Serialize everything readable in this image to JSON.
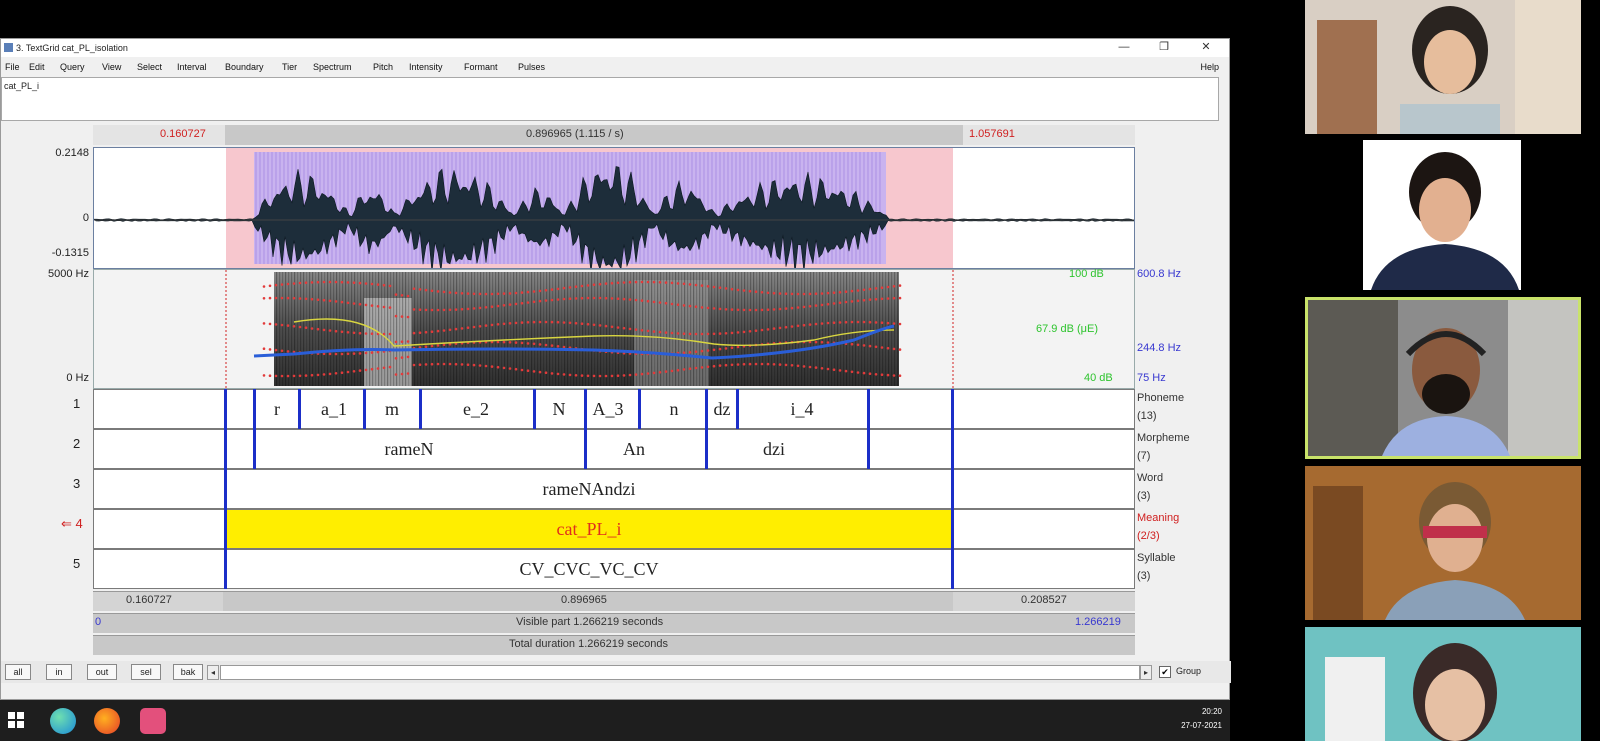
{
  "window": {
    "title": "3. TextGrid cat_PL_isolation",
    "minimize": "—",
    "restore": "❐",
    "close": "✕"
  },
  "menu": [
    "File",
    "Edit",
    "Query",
    "View",
    "Select",
    "Interval",
    "Boundary",
    "Tier",
    "Spectrum",
    "Pitch",
    "Intensity",
    "Formant",
    "Pulses"
  ],
  "menu_help": "Help",
  "text_field": "cat_PL_i",
  "selection": {
    "start": "0.160727",
    "duration": "0.896965 (1.115 / s)",
    "end": "1.057691"
  },
  "waveform": {
    "max": "0.2148",
    "zero": "0",
    "min": "-0.1315"
  },
  "spectrogram": {
    "top_hz": "5000 Hz",
    "bottom_hz": "0 Hz",
    "right_top_db": "100 dB",
    "right_top_hz": "600.8 Hz",
    "right_mid_db": "67.9 dB (μE)",
    "right_mid_hz": "244.8 Hz",
    "right_bot_db": "40 dB",
    "right_bot_hz": "75 Hz"
  },
  "tiers": [
    {
      "num": "1",
      "name": "Phoneme",
      "count": "(13)"
    },
    {
      "num": "2",
      "name": "Morpheme",
      "count": "(7)"
    },
    {
      "num": "3",
      "name": "Word",
      "count": "(3)"
    },
    {
      "num": "4",
      "name": "Meaning",
      "count": "(2/3)",
      "arrow": "⇐"
    },
    {
      "num": "5",
      "name": "Syllable",
      "count": "(3)"
    }
  ],
  "phonemes": [
    "r",
    "a_1",
    "m",
    "e_2",
    "N",
    "A_3",
    "n",
    "dz",
    "i_4"
  ],
  "morphemes": [
    "rameN",
    "An",
    "dzi"
  ],
  "word": "rameNAndzi",
  "meaning": "cat_PL_i",
  "syllable": "CV_CVC_VC_CV",
  "bottom": {
    "left": "0.160727",
    "mid": "0.896965",
    "right": "0.208527",
    "visible_start": "0",
    "visible_text": "Visible part 1.266219 seconds",
    "visible_end": "1.266219",
    "total_text": "Total duration 1.266219 seconds"
  },
  "buttons": [
    "all",
    "in",
    "out",
    "sel",
    "bak"
  ],
  "group_label": "Group",
  "scroll_left": "◂",
  "scroll_right": "▸",
  "checkbox_mark": "✔",
  "clock": {
    "time": "20:20",
    "date": "27-07-2021"
  },
  "colors": {
    "selection": "#f7c7ce",
    "pitch": "#2a5ed8",
    "boundary": "#1b2ec8",
    "meaning_fill": "#ffee00",
    "meaning_text": "#e0301c",
    "speaker_border": "#c9e36a"
  },
  "icons": [
    "windows-start-icon",
    "edge-icon",
    "firefox-icon",
    "praat-icon"
  ]
}
